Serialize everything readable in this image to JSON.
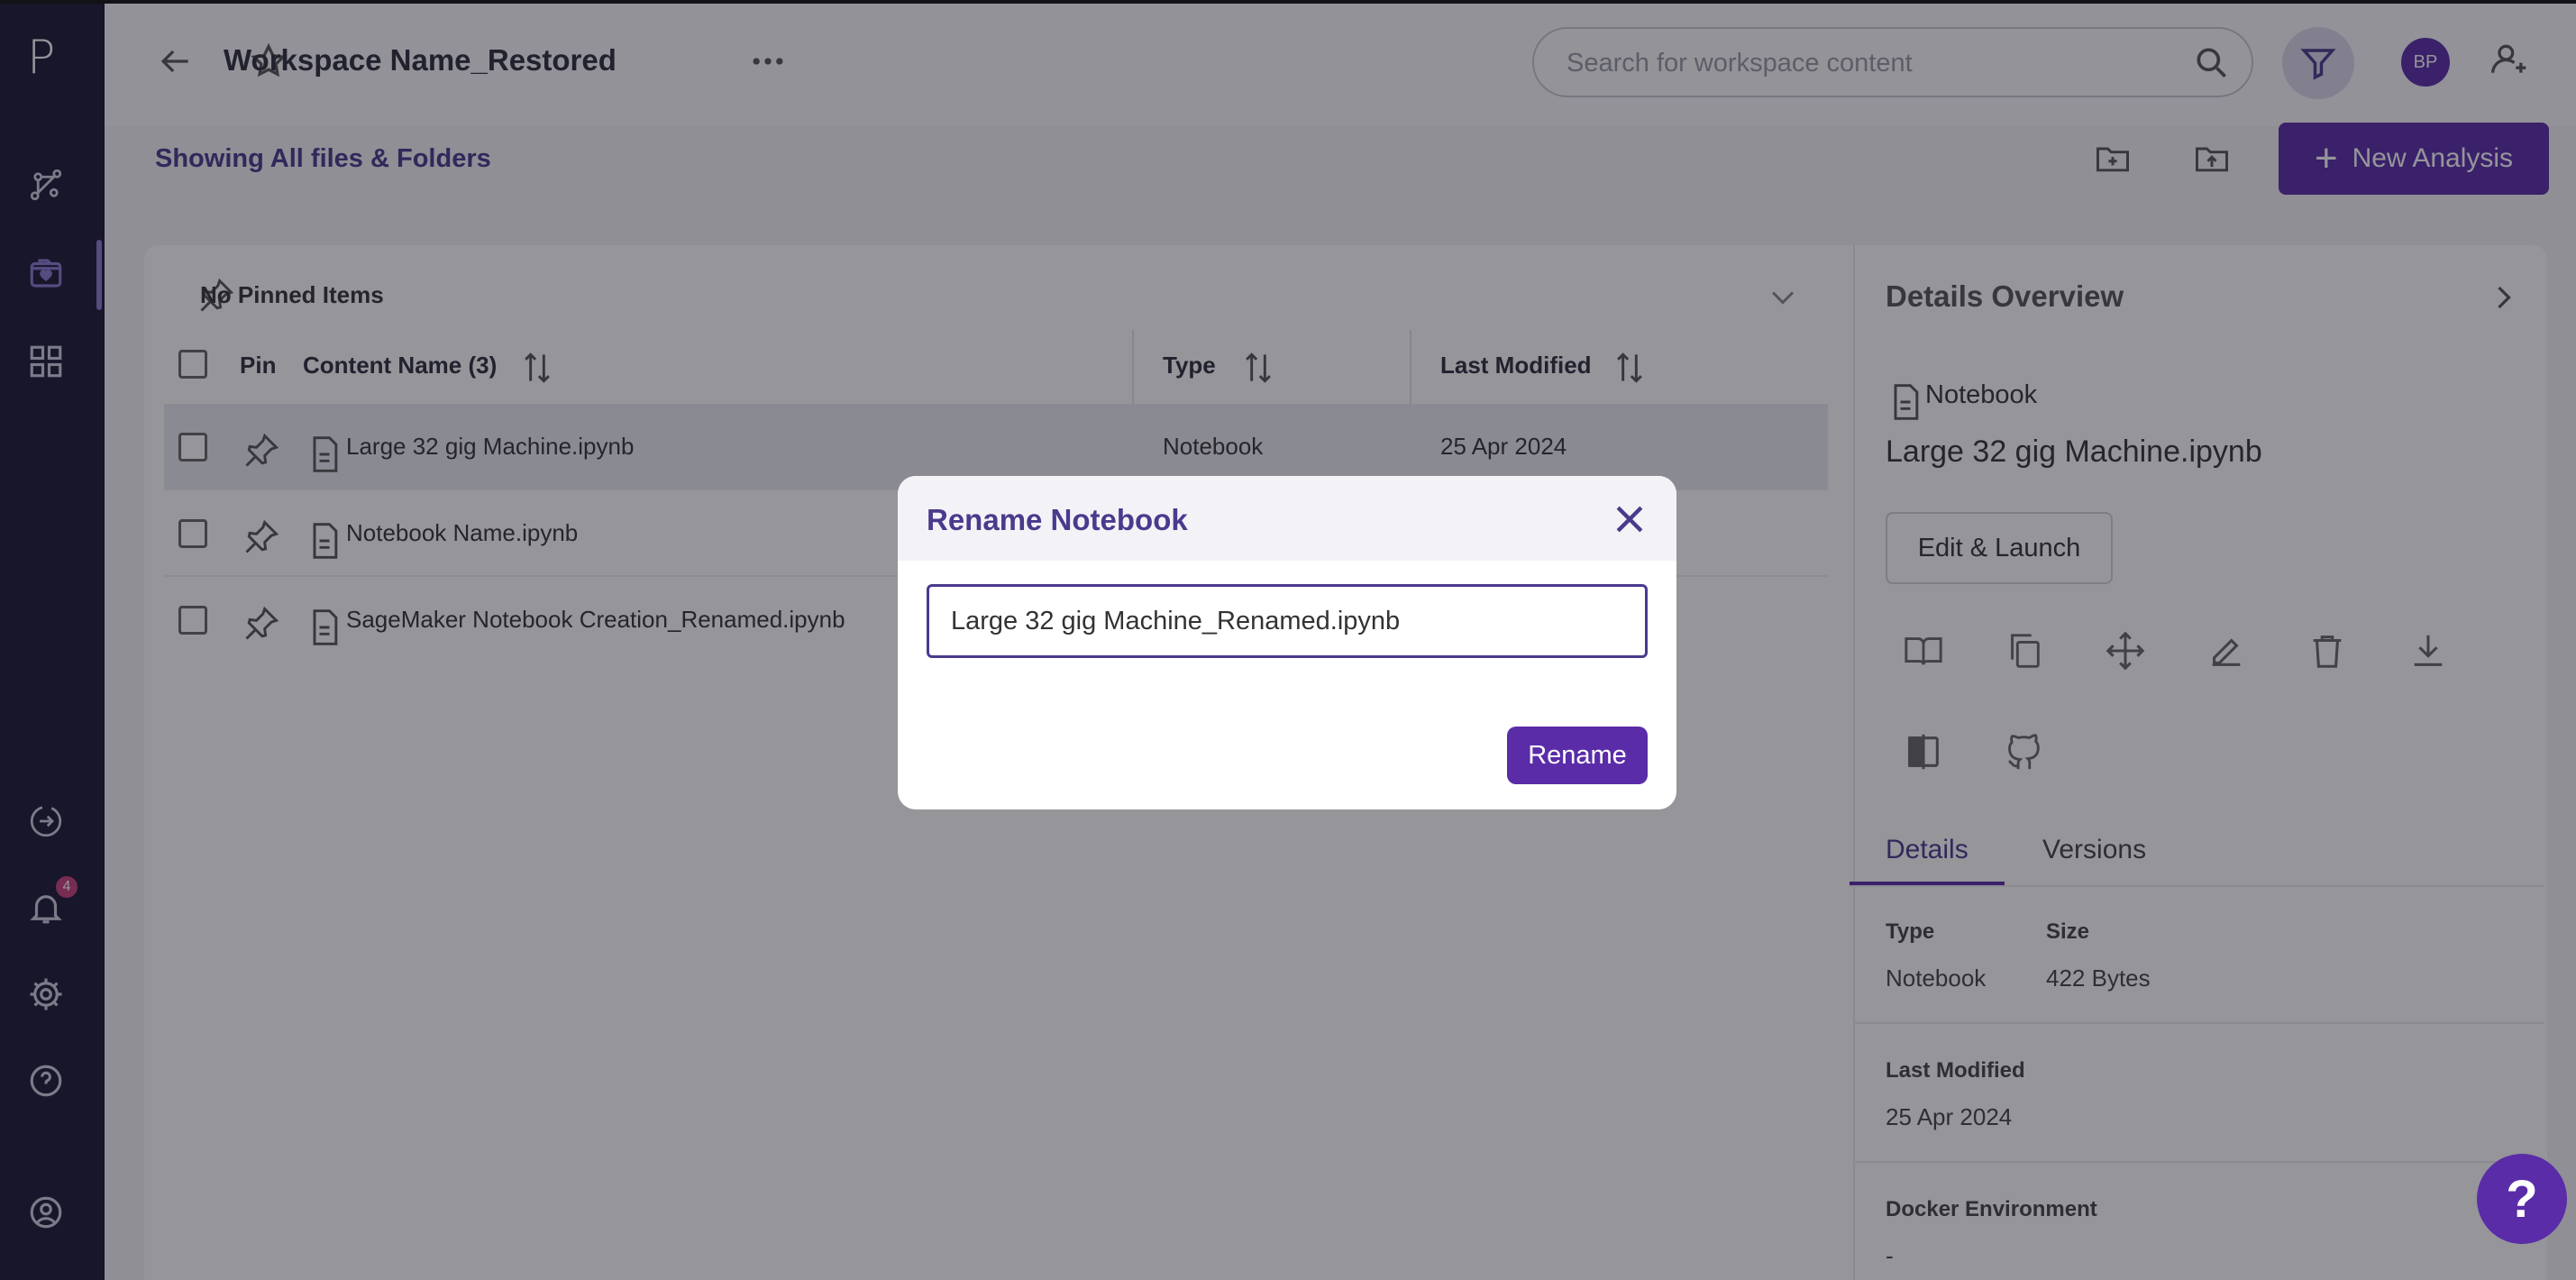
{
  "app": {
    "logo": "P"
  },
  "header": {
    "title": "Workspace Name_Restored",
    "search_placeholder": "Search for workspace content",
    "avatar_initials": "BP"
  },
  "subheader": {
    "showing": "Showing All files & Folders",
    "new_analysis": "New Analysis"
  },
  "notifications": {
    "count": "4"
  },
  "list": {
    "pinned_label": "No Pinned Items",
    "headers": {
      "pin": "Pin",
      "name": "Content Name (3)",
      "type": "Type",
      "modified": "Last Modified"
    },
    "rows": [
      {
        "name": "Large 32 gig Machine.ipynb",
        "type": "Notebook",
        "modified": "25 Apr 2024"
      },
      {
        "name": "Notebook Name.ipynb",
        "type": "",
        "modified": ""
      },
      {
        "name": "SageMaker Notebook Creation_Renamed.ipynb",
        "type": "",
        "modified": ""
      }
    ]
  },
  "details": {
    "title": "Details Overview",
    "type_label": "Notebook",
    "name": "Large 32 gig Machine.ipynb",
    "edit_launch": "Edit & Launch",
    "tabs": [
      "Details",
      "Versions"
    ],
    "fields": {
      "type_label": "Type",
      "type_value": "Notebook",
      "size_label": "Size",
      "size_value": "422 Bytes",
      "modified_label": "Last Modified",
      "modified_value": "25 Apr 2024",
      "docker_label": "Docker Environment",
      "docker_value": "-"
    }
  },
  "modal": {
    "title": "Rename Notebook",
    "input_value": "Large 32 gig Machine_Renamed.ipynb",
    "rename_button": "Rename"
  },
  "help": {
    "label": "?"
  },
  "colors": {
    "accent": "#5a2ca8",
    "rail": "#1c1934",
    "title_purple": "#4b3a8c"
  }
}
